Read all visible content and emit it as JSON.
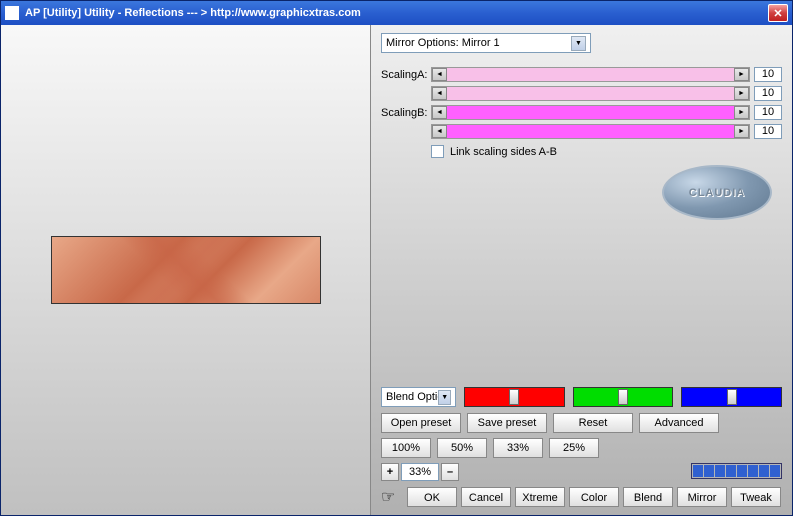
{
  "titlebar": {
    "title": "AP [Utility]  Utility - Reflections     --- > http://www.graphicxtras.com"
  },
  "mirror_dropdown": "Mirror Options: Mirror 1",
  "scalingA": {
    "label": "ScalingA:",
    "v1": "10",
    "v2": "10"
  },
  "scalingB": {
    "label": "ScalingB:",
    "v1": "10",
    "v2": "10"
  },
  "link_checkbox": "Link scaling sides A-B",
  "badge": "CLAUDIA",
  "blend_dd": "Blend Option",
  "preset_row": {
    "open": "Open preset",
    "save": "Save preset",
    "reset": "Reset",
    "advanced": "Advanced"
  },
  "pct_row": {
    "p100": "100%",
    "p50": "50%",
    "p33": "33%",
    "p25": "25%"
  },
  "zoom": {
    "plus": "+",
    "value": "33%",
    "minus": "–"
  },
  "actions": {
    "ok": "OK",
    "cancel": "Cancel",
    "xtreme": "Xtreme",
    "color": "Color",
    "blend": "Blend",
    "mirror": "Mirror",
    "tweak": "Tweak"
  }
}
